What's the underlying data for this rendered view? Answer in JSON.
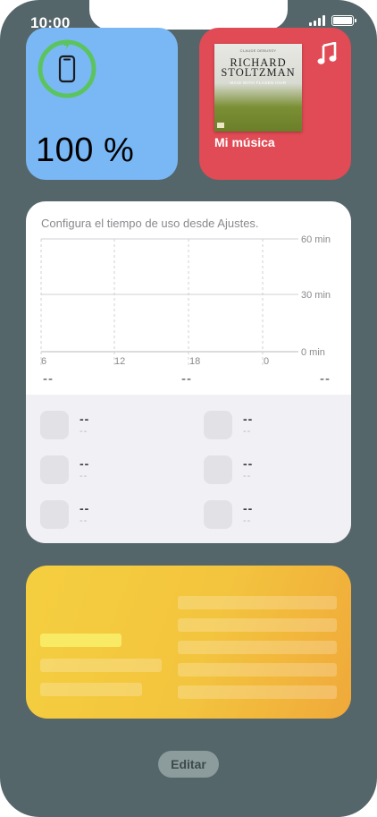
{
  "status_bar": {
    "time": "10:00"
  },
  "battery_widget": {
    "percent_text": "100 %",
    "level": 1.0,
    "ring_color": "#5bc45f",
    "bg": "#7ab8f5"
  },
  "music_widget": {
    "label": "Mi música",
    "album": {
      "composer": "CLAUDE DEBUSSY",
      "artist": "RICHARD STOLTZMAN",
      "subtitle": "MAID WITH FLAXEN HAIR"
    },
    "note_icon": "music-note-icon",
    "bg": "#e04b55"
  },
  "screentime_widget": {
    "info": "Configura el tiempo de uso desde Ajustes.",
    "y_labels": [
      "60 min",
      "30 min",
      "0 min"
    ],
    "x_labels": [
      "6",
      "12",
      "18",
      "0"
    ],
    "summary": [
      "--",
      "--",
      "--"
    ],
    "apps": [
      {
        "name": "--",
        "time": "--"
      },
      {
        "name": "--",
        "time": "--"
      },
      {
        "name": "--",
        "time": "--"
      },
      {
        "name": "--",
        "time": "--"
      },
      {
        "name": "--",
        "time": "--"
      },
      {
        "name": "--",
        "time": "--"
      }
    ]
  },
  "edit_button": {
    "label": "Editar"
  }
}
